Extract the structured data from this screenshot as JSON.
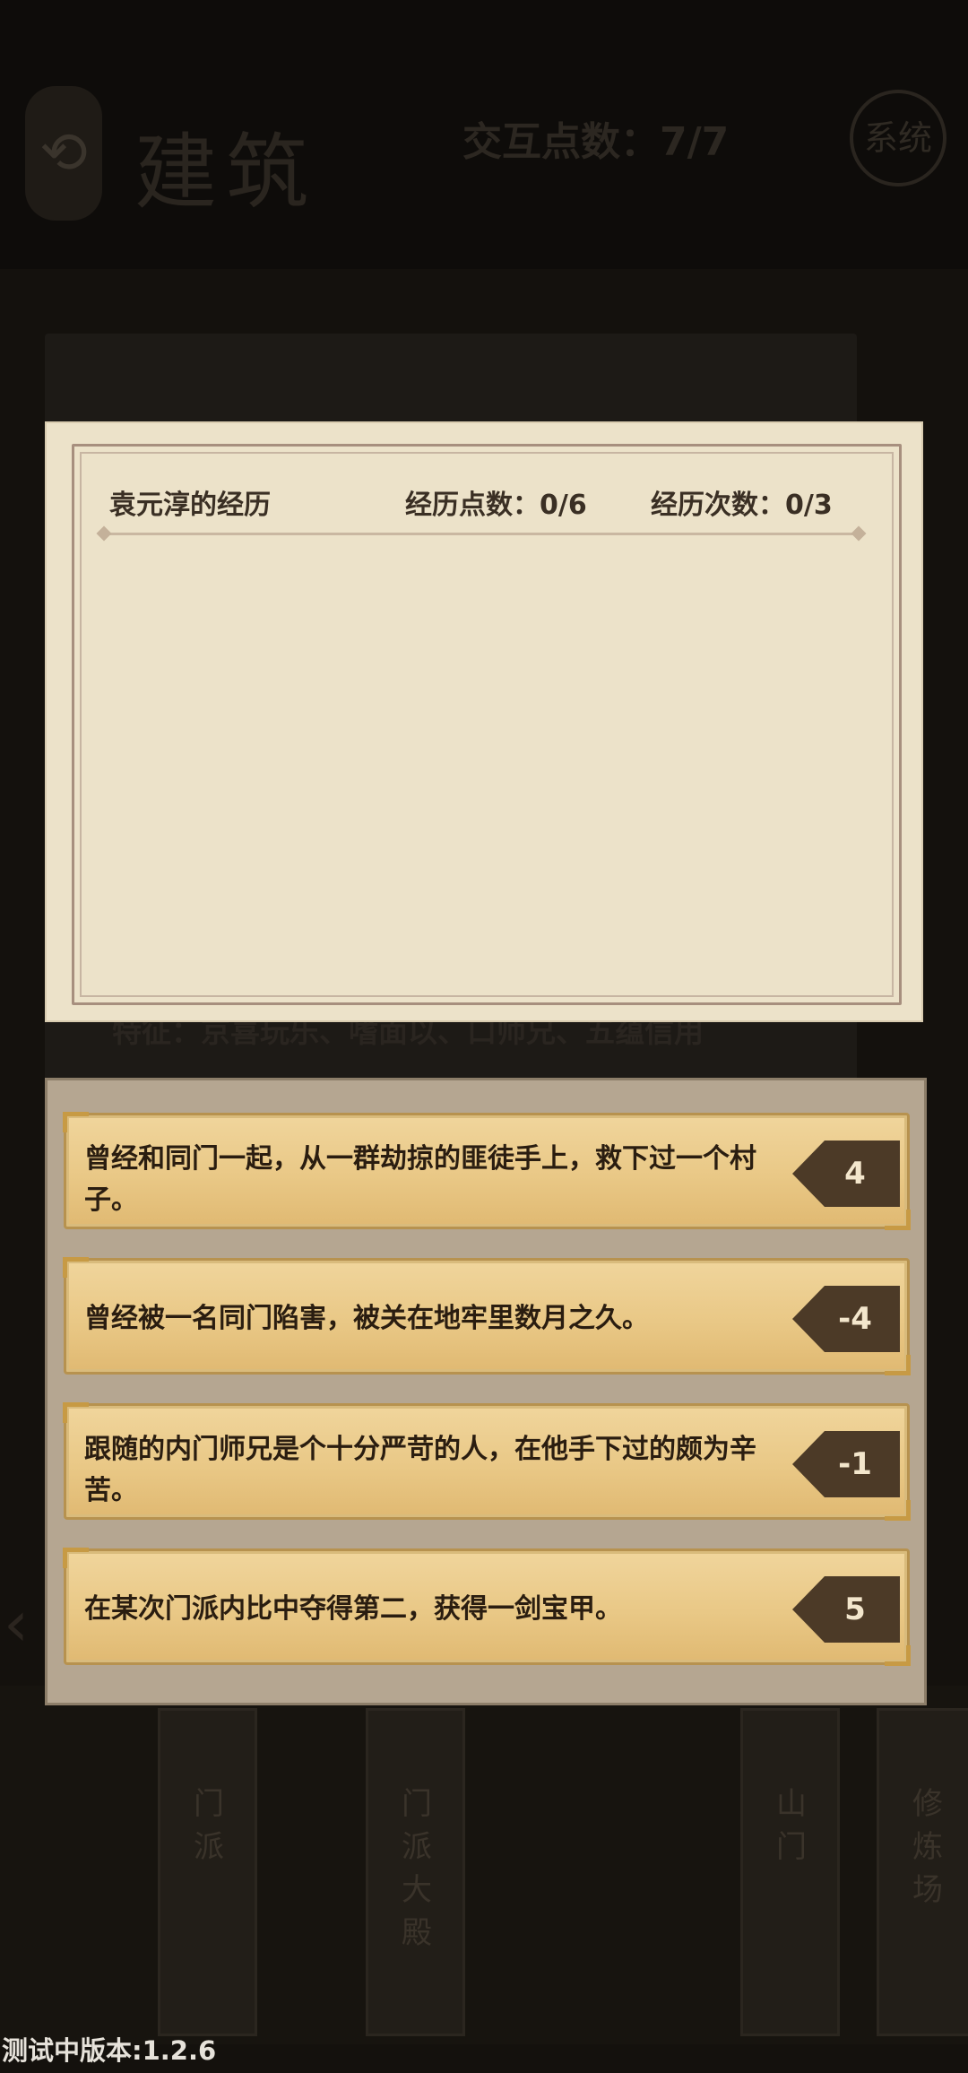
{
  "background": {
    "back_glyph": "⟲",
    "page_title": "建筑",
    "interaction_points_label": "交互点数：7/7",
    "system_button": "系统",
    "trait_line": "特征：京喜玩乐、嗜面以、口师兄、五蕴信用",
    "building_cards": [
      {
        "label": "门派"
      },
      {
        "label": "门派大殿"
      },
      {
        "label": "山门"
      },
      {
        "label": "修炼场"
      }
    ]
  },
  "experience_dialog": {
    "title": "袁元淳的经历",
    "points": "经历点数：0/6",
    "count": "经历次数：0/3"
  },
  "options": [
    {
      "text": "曾经和同门一起，从一群劫掠的匪徒手上，救下过一个村子。",
      "value": "4"
    },
    {
      "text": "曾经被一名同门陷害，被关在地牢里数月之久。",
      "value": "-4"
    },
    {
      "text": "跟随的内门师兄是个十分严苛的人，在他手下过的颇为辛苦。",
      "value": "-1"
    },
    {
      "text": "在某次门派内比中夺得第二，获得一剑宝甲。",
      "value": "5"
    }
  ],
  "footer": {
    "version": "测试中版本:1.2.6"
  }
}
